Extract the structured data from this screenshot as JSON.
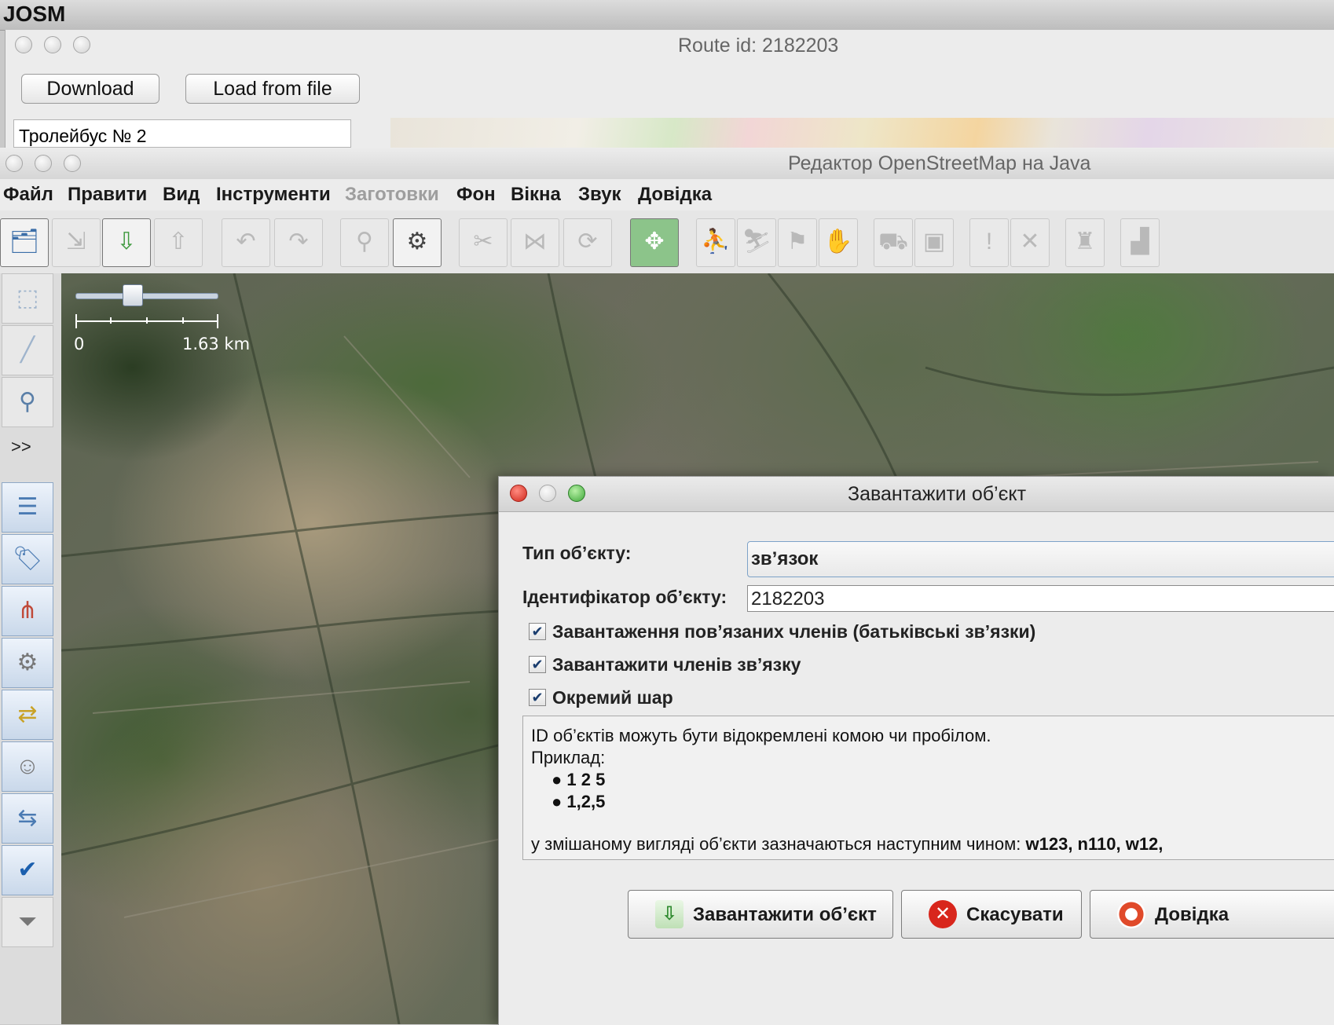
{
  "system": {
    "app_name": "JOSM"
  },
  "route_window": {
    "title": "Route id: 2182203",
    "download_label": "Download",
    "load_from_file_label": "Load from file",
    "list_first_item": "Тролейбус № 2"
  },
  "main_window": {
    "title": "Редактор OpenStreetMap на Java",
    "menu": [
      "Файл",
      "Правити",
      "Вид",
      "Інструменти",
      "Заготовки",
      "Фон",
      "Вікна",
      "Звук",
      "Довідка"
    ],
    "menu_disabled": [
      "Заготовки"
    ],
    "toolbar_icons": [
      "open-file-icon",
      "save-icon",
      "download-icon",
      "upload-icon",
      "undo-icon",
      "redo-icon",
      "zoom-search-icon",
      "preferences-icon",
      "split-way-icon",
      "combine-way-icon",
      "refresh-icon",
      "zoom-fit-icon",
      "sport-icon",
      "sport-icon-2",
      "sport-icon-3",
      "hand-icon",
      "car-icon",
      "bus-icon",
      "warning-icon",
      "tools-icon",
      "castle-icon",
      "industry-icon"
    ],
    "sidebar_more_label": ">>",
    "sidebar_icons": [
      "select-mode-icon",
      "draw-mode-icon",
      "zoom-mode-icon",
      "layers-icon",
      "tags-icon",
      "relation-icon",
      "toggle-dialog-icon",
      "conflict-icon",
      "user-icon",
      "merge-icon",
      "validator-icon",
      "filter-icon"
    ]
  },
  "map": {
    "scale_start": "0",
    "scale_end": "1.63 km"
  },
  "dialog": {
    "title": "Завантажити об’єкт",
    "object_type_label": "Тип об’єкту:",
    "object_type_value": "зв’язок",
    "object_id_label": "Ідентифікатор об’єкту:",
    "object_id_value": "2182203",
    "checkboxes": [
      {
        "label": "Завантаження пов’язаних членів (батьківські зв’язки)",
        "checked": true
      },
      {
        "label": "Завантажити членів зв’язку",
        "checked": true
      },
      {
        "label": "Окремий шар",
        "checked": true
      }
    ],
    "info_line1": "ID об’єктів можуть бути відокремлені комою чи пробілом.",
    "info_line2": "Приклад:",
    "info_example1": "1 2 5",
    "info_example2": "1,2,5",
    "info_line3_prefix": "у змішаному вигляді об’єкти зазначаються наступним чином:",
    "info_line3_example": "w123, n110, w12,",
    "download_button": "Завантажити об’єкт",
    "cancel_button": "Скасувати",
    "help_button": "Довідка"
  }
}
